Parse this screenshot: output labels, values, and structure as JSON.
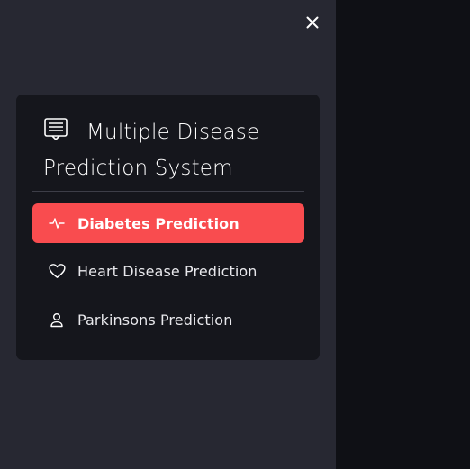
{
  "sidebar": {
    "close_icon": "close-icon",
    "menu": {
      "title": "Multiple Disease Prediction System",
      "title_icon": "document-list-icon",
      "items": [
        {
          "label": "Diabetes Prediction",
          "icon": "activity-icon",
          "active": true
        },
        {
          "label": "Heart Disease Prediction",
          "icon": "heart-icon",
          "active": false
        },
        {
          "label": "Parkinsons Prediction",
          "icon": "person-icon",
          "active": false
        }
      ]
    }
  },
  "colors": {
    "sidebar_bg": "#272832",
    "card_bg": "#15161c",
    "main_bg": "#0f1015",
    "accent": "#f94c4f",
    "text": "#e8e8ec"
  }
}
